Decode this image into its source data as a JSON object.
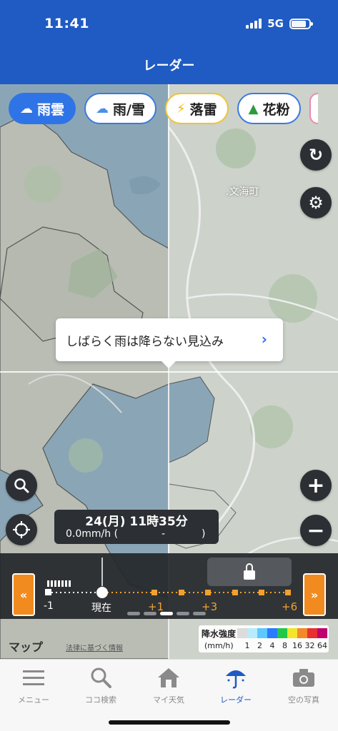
{
  "status_bar": {
    "time": "11:41",
    "network": "5G"
  },
  "header": {
    "title": "レーダー"
  },
  "chips": [
    {
      "label": "雨雲",
      "icon": "cloud-rain-icon",
      "active": true
    },
    {
      "label": "雨/雪",
      "icon": "cloud-snow-icon",
      "active": false
    },
    {
      "label": "落雷",
      "icon": "lightning-icon",
      "active": false
    },
    {
      "label": "花粉",
      "icon": "tree-icon",
      "active": false
    }
  ],
  "map": {
    "place_label": ".文海町",
    "forecast_message": "しばらく雨は降らない見込み"
  },
  "info": {
    "datetime": "24(月) 11時35分",
    "rate": "0.0mm/h (",
    "dash": "-",
    "paren_close": ")"
  },
  "timeline": {
    "labels": {
      "minus1": "-1",
      "now": "現在",
      "plus1": "+1",
      "plus3": "+3",
      "plus6": "+6"
    },
    "current_position": "現在"
  },
  "map_attribution": {
    "brand": "マップ",
    "legal": "法律に基づく情報"
  },
  "legend": {
    "title": "降水強度",
    "unit": "(mm/h)",
    "values": [
      "1",
      "2",
      "4",
      "8",
      "16",
      "32",
      "64"
    ],
    "colors": [
      "#dcdcdc",
      "#b7ecff",
      "#5bc8ff",
      "#2a7bff",
      "#22c84a",
      "#f2e62a",
      "#f28a2a",
      "#e83030",
      "#c0006f"
    ]
  },
  "tabs": [
    {
      "label": "メニュー",
      "icon": "menu-icon",
      "active": false
    },
    {
      "label": "ココ検索",
      "icon": "search-icon",
      "active": false
    },
    {
      "label": "マイ天気",
      "icon": "home-icon",
      "active": false
    },
    {
      "label": "レーダー",
      "icon": "umbrella-icon",
      "active": true
    },
    {
      "label": "空の写真",
      "icon": "camera-icon",
      "active": false
    }
  ]
}
